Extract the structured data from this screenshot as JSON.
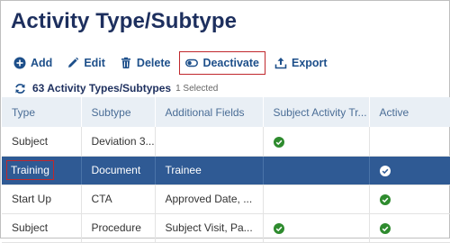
{
  "page": {
    "title": "Activity Type/Subtype"
  },
  "toolbar": {
    "add_label": "Add",
    "edit_label": "Edit",
    "delete_label": "Delete",
    "deactivate_label": "Deactivate",
    "export_label": "Export"
  },
  "summary": {
    "total": "63 Activity Types/Subtypes",
    "selected": "1 Selected"
  },
  "table": {
    "columns": [
      "Type",
      "Subtype",
      "Additional Fields",
      "Subject Activity Tr...",
      "Active"
    ],
    "rows": [
      {
        "type": "Subject",
        "subtype": "Deviation 3...",
        "additional_fields": "",
        "subject_activity": true,
        "active": false,
        "selected": false
      },
      {
        "type": "Training",
        "subtype": "Document",
        "additional_fields": "Trainee",
        "subject_activity": false,
        "active": true,
        "selected": true
      },
      {
        "type": "Start Up",
        "subtype": "CTA",
        "additional_fields": "Approved Date, ...",
        "subject_activity": false,
        "active": true,
        "selected": false
      },
      {
        "type": "Subject",
        "subtype": "Procedure",
        "additional_fields": "Subject Visit, Pa...",
        "subject_activity": true,
        "active": true,
        "selected": false
      }
    ]
  },
  "colors": {
    "accent": "#1d4f8a",
    "title": "#1d2f5e",
    "selected_row": "#2f5a94",
    "check": "#2e8b2e",
    "highlight_border": "#c0282d"
  },
  "icons": {
    "add": "plus-circle-icon",
    "edit": "pencil-icon",
    "delete": "trash-icon",
    "deactivate": "toggle-icon",
    "export": "export-icon",
    "refresh": "refresh-icon",
    "check": "check-circle-icon"
  }
}
